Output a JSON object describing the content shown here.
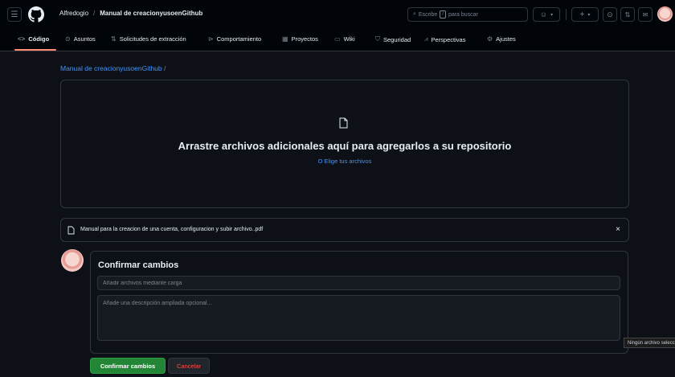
{
  "header": {
    "menu_icon": "hamburger-icon",
    "logo_icon": "github-logo-icon",
    "owner": "Alfredogio",
    "separator": "/",
    "repo": "Manual de creacionyusoenGithub",
    "search": {
      "prefix": "Escribe",
      "key": "/",
      "suffix": "para buscar",
      "icon": "search-icon"
    }
  },
  "nav": {
    "tabs": [
      {
        "label": "Código",
        "icon": "code-icon",
        "active": true
      },
      {
        "label": "Asuntos",
        "icon": "issue-opened-icon"
      },
      {
        "label": "Solicitudes de extracción",
        "icon": "git-pull-request-icon"
      },
      {
        "label": "Comportamiento",
        "icon": "play-icon"
      },
      {
        "label": "Proyectos",
        "icon": "table-icon"
      },
      {
        "label": "Wiki",
        "icon": "book-icon"
      },
      {
        "label": "Seguridad",
        "icon": "shield-icon"
      },
      {
        "label": "Perspectivas",
        "icon": "graph-icon"
      },
      {
        "label": "Ajustes",
        "icon": "gear-icon"
      }
    ]
  },
  "main": {
    "path_repo": "Manual de creacionyusoenGithub",
    "path_slash": "/",
    "drop_title": "Arrastre archivos adicionales aquí para agregarlos a su repositorio",
    "drop_link": "O Elige tus archivos",
    "file_name": "Manual para la creacion de una cuenta, configuracion y subir archivo..pdf",
    "remove_label": "×"
  },
  "commit": {
    "title": "Confirmar cambios",
    "summary_placeholder": "Añadir archivos mediante carga",
    "description_placeholder": "Añade una descripción ampliada opcional...",
    "confirm_label": "Confirmar cambios",
    "cancel_label": "Cancelar"
  },
  "tooltip": "Ningún archivo seleccionado",
  "colors": {
    "background": "#0d1117",
    "header": "#010409",
    "accent_link": "#4493f8",
    "primary_button": "#238636",
    "danger_text": "#f85149",
    "active_tab_underline": "#fd8c73"
  }
}
